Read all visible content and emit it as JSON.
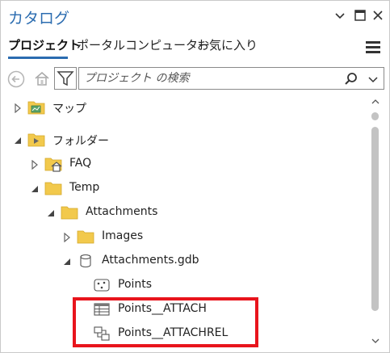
{
  "window": {
    "title": "カタログ"
  },
  "tabs": [
    {
      "label": "プロジェクト",
      "active": true
    },
    {
      "label": "ポータル",
      "active": false
    },
    {
      "label": "コンピューター",
      "active": false
    },
    {
      "label": "お気に入り",
      "active": false
    }
  ],
  "search": {
    "placeholder": "プロジェクト の検索"
  },
  "tree": {
    "maps": {
      "label": "マップ",
      "expanded": false
    },
    "folders": {
      "label": "フォルダー",
      "expanded": true
    },
    "faq": {
      "label": "FAQ",
      "expanded": false
    },
    "temp": {
      "label": "Temp",
      "expanded": true
    },
    "attachments": {
      "label": "Attachments",
      "expanded": true
    },
    "images": {
      "label": "Images",
      "expanded": false
    },
    "gdb": {
      "label": "Attachments.gdb",
      "expanded": true
    },
    "points": {
      "label": "Points"
    },
    "points_attach": {
      "label": "Points__ATTACH"
    },
    "points_attachrel": {
      "label": "Points__ATTACHREL"
    }
  },
  "colors": {
    "accent": "#2b6cb0",
    "folder": "#f2c94c",
    "highlight": "#e8141c"
  }
}
